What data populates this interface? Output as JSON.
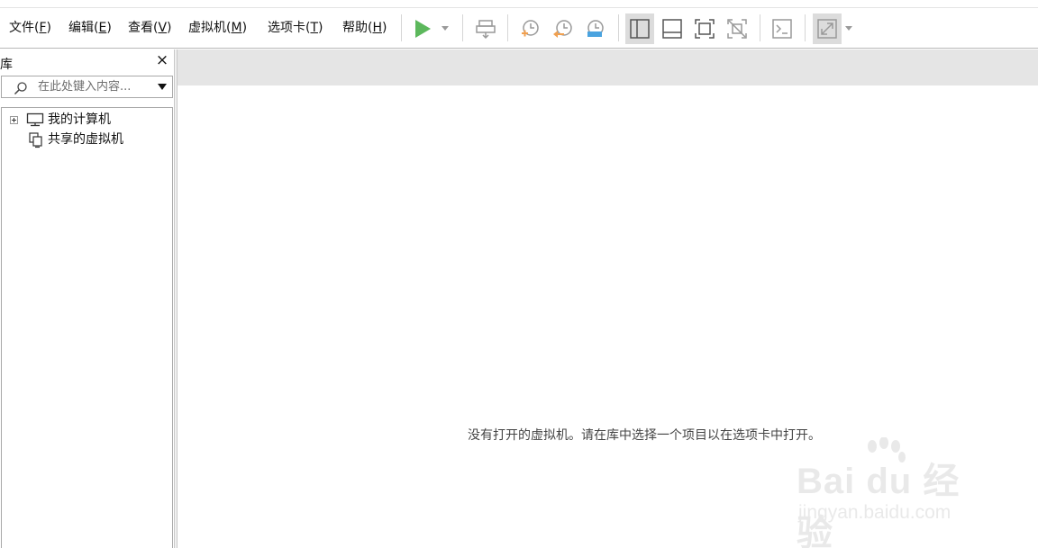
{
  "menu": [
    {
      "label": "文件(",
      "mnemonic": "F",
      "suffix": ")"
    },
    {
      "label": "编辑(",
      "mnemonic": "E",
      "suffix": ")"
    },
    {
      "label": "查看(",
      "mnemonic": "V",
      "suffix": ")"
    },
    {
      "label": "虚拟机(",
      "mnemonic": "M",
      "suffix": ")"
    },
    {
      "label": "选项卡(",
      "mnemonic": "T",
      "suffix": ")"
    },
    {
      "label": "帮助(",
      "mnemonic": "H",
      "suffix": ")"
    }
  ],
  "toolbar": {
    "icons": [
      "play-icon",
      "send-ctrl-alt-del-icon",
      "snapshot-take-icon",
      "snapshot-revert-icon",
      "snapshot-manager-icon",
      "show-library-icon",
      "show-thumbnail-bar-icon",
      "full-screen-icon",
      "unity-icon",
      "console-view-icon",
      "stretch-guest-icon"
    ],
    "play_color": "#5cb85c",
    "accent_orange": "#f0a050",
    "accent_blue": "#4aa3df"
  },
  "library": {
    "title": "库",
    "close_glyph": "×",
    "search_placeholder": "在此处键入内容...",
    "tree": [
      {
        "label": "我的计算机",
        "icon": "computer-icon",
        "expandable": true
      },
      {
        "label": "共享的虚拟机",
        "icon": "shared-vm-icon",
        "expandable": false
      }
    ]
  },
  "main": {
    "empty_message": "没有打开的虚拟机。请在库中选择一个项目以在选项卡中打开。"
  },
  "watermark": {
    "brand": "Bai du 经验",
    "url": "jingyan.baidu.com"
  }
}
